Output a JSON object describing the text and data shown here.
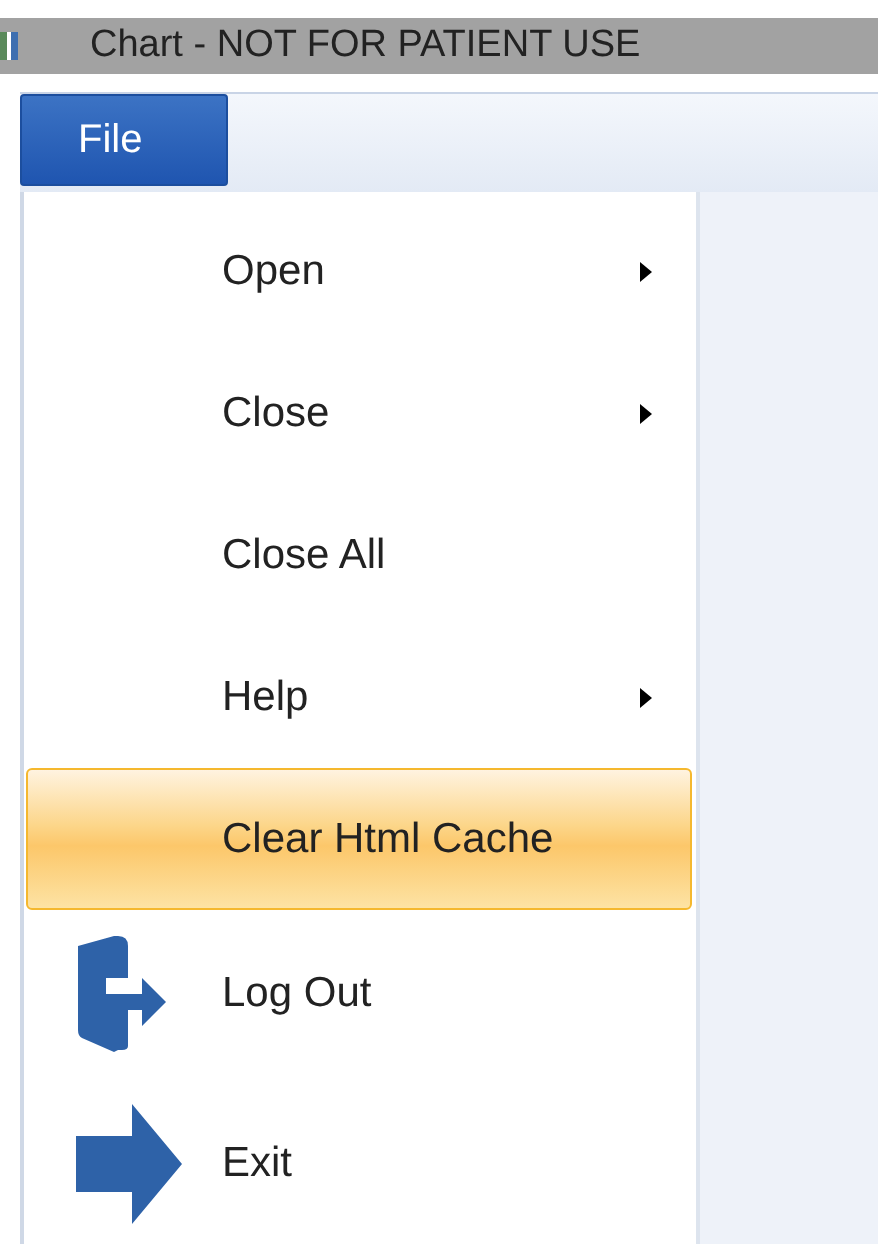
{
  "window": {
    "title": "Chart - NOT FOR PATIENT USE"
  },
  "menu_bar": [
    {
      "label": "File",
      "selected": true
    }
  ],
  "file_menu": [
    {
      "kind": "plain",
      "label": "Open",
      "has_submenu": true,
      "selected": false
    },
    {
      "kind": "plain",
      "label": "Close",
      "has_submenu": true,
      "selected": false
    },
    {
      "kind": "plain",
      "label": "Close All",
      "has_submenu": false,
      "selected": false
    },
    {
      "kind": "plain",
      "label": "Help",
      "has_submenu": true,
      "selected": false
    },
    {
      "kind": "plain",
      "label": "Clear Html Cache",
      "has_submenu": false,
      "selected": true
    },
    {
      "kind": "logout",
      "label": "Log Out",
      "has_submenu": false,
      "selected": false
    },
    {
      "kind": "exit",
      "label": "Exit",
      "has_submenu": false,
      "selected": false
    }
  ]
}
